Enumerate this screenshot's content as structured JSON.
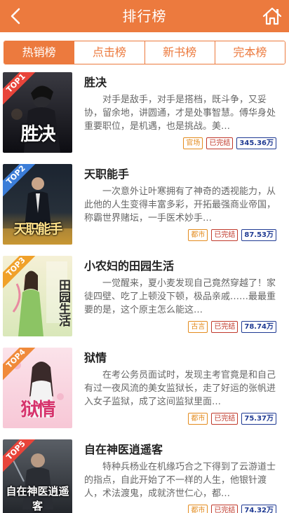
{
  "header": {
    "title": "排行榜",
    "back_icon": "chevron-left-icon",
    "home_icon": "home-icon"
  },
  "tabs": [
    {
      "label": "热销榜",
      "active": true
    },
    {
      "label": "点击榜",
      "active": false
    },
    {
      "label": "新书榜",
      "active": false
    },
    {
      "label": "完本榜",
      "active": false
    }
  ],
  "colors": {
    "accent": "#ec7a3e",
    "genre_tag": "#e38b1e",
    "status_tag": "#c0392b",
    "words_tag": "#1f3a93"
  },
  "books": [
    {
      "rank": "TOP1",
      "title": "胜决",
      "cover_text": "胜决",
      "description": "对手是敌手，对手是搭档，既斗争，又妥协，留余地，讲圆通，才是处事智慧。傅华身处重要职位，是机遇，也是挑战。美…",
      "genre": "官场",
      "status": "已完结",
      "words": "345.36万"
    },
    {
      "rank": "TOP2",
      "title": "天职能手",
      "cover_text": "天职能手",
      "description": "一次意外让叶寒拥有了神奇的透视能力，从此他的人生变得丰富多彩，开拓最强商业帝国，称霸世界赌坛，一手医术妙手…",
      "genre": "都市",
      "status": "已完结",
      "words": "87.53万"
    },
    {
      "rank": "TOP3",
      "title": "小农妇的田园生活",
      "cover_text": "田园生活",
      "description": "一觉醒来，夏小麦发现自己竟然穿越了！家徒四壁、吃了上顿没下顿，极品亲戚……最最重要的是，这个原主怎么能这…",
      "genre": "古言",
      "status": "已完结",
      "words": "78.74万"
    },
    {
      "rank": "TOP4",
      "title": "狱情",
      "cover_text": "狱情",
      "description": "在考公务员面试时，发现主考官竟是和自己有过一夜风流的美女监狱长，走了好运的张帆进入女子监狱，成了这间监狱里面…",
      "genre": "都市",
      "status": "已完结",
      "words": "75.37万"
    },
    {
      "rank": "TOP5",
      "title": "自在神医逍遥客",
      "cover_text": "自在神医逍遥客",
      "description": "特种兵杨业在机缘巧合之下得到了云游道士的指点，自此开始了不一样的人生，他银针渡人，术法渡鬼，成就济世仁心，都…",
      "genre": "都市",
      "status": "已完结",
      "words": "74.32万"
    }
  ]
}
